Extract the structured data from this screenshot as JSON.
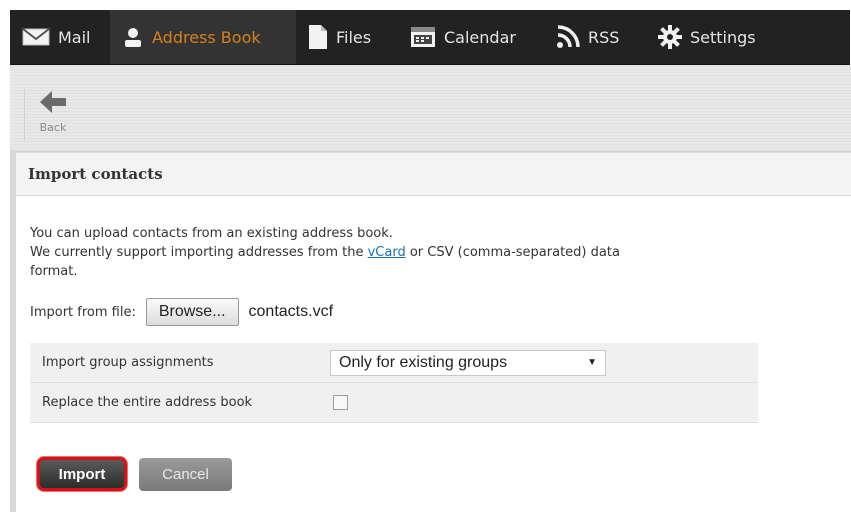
{
  "nav": {
    "items": [
      {
        "label": "Mail",
        "icon": "mail-icon"
      },
      {
        "label": "Address Book",
        "icon": "user-icon",
        "active": true
      },
      {
        "label": "Files",
        "icon": "file-icon"
      },
      {
        "label": "Calendar",
        "icon": "calendar-icon"
      },
      {
        "label": "RSS",
        "icon": "rss-icon"
      },
      {
        "label": "Settings",
        "icon": "gear-icon"
      }
    ],
    "active_color": "#d6811d"
  },
  "toolbar": {
    "back_label": "Back",
    "back_icon": "arrow-left-icon"
  },
  "panel": {
    "title": "Import contacts",
    "intro_line1": "You can upload contacts from an existing address book.",
    "intro_line2_before": "We currently support importing addresses from the ",
    "intro_link": "vCard",
    "intro_line2_after": " or CSV (comma-separated) data",
    "intro_line3": "format.",
    "file_label": "Import from file:",
    "browse_label": "Browse...",
    "file_name": "contacts.vcf"
  },
  "options": {
    "group_label": "Import group assignments",
    "group_value": "Only for existing groups",
    "replace_label": "Replace the entire address book",
    "replace_checked": false
  },
  "actions": {
    "import_label": "Import",
    "cancel_label": "Cancel",
    "highlight_color": "#d0141c"
  }
}
